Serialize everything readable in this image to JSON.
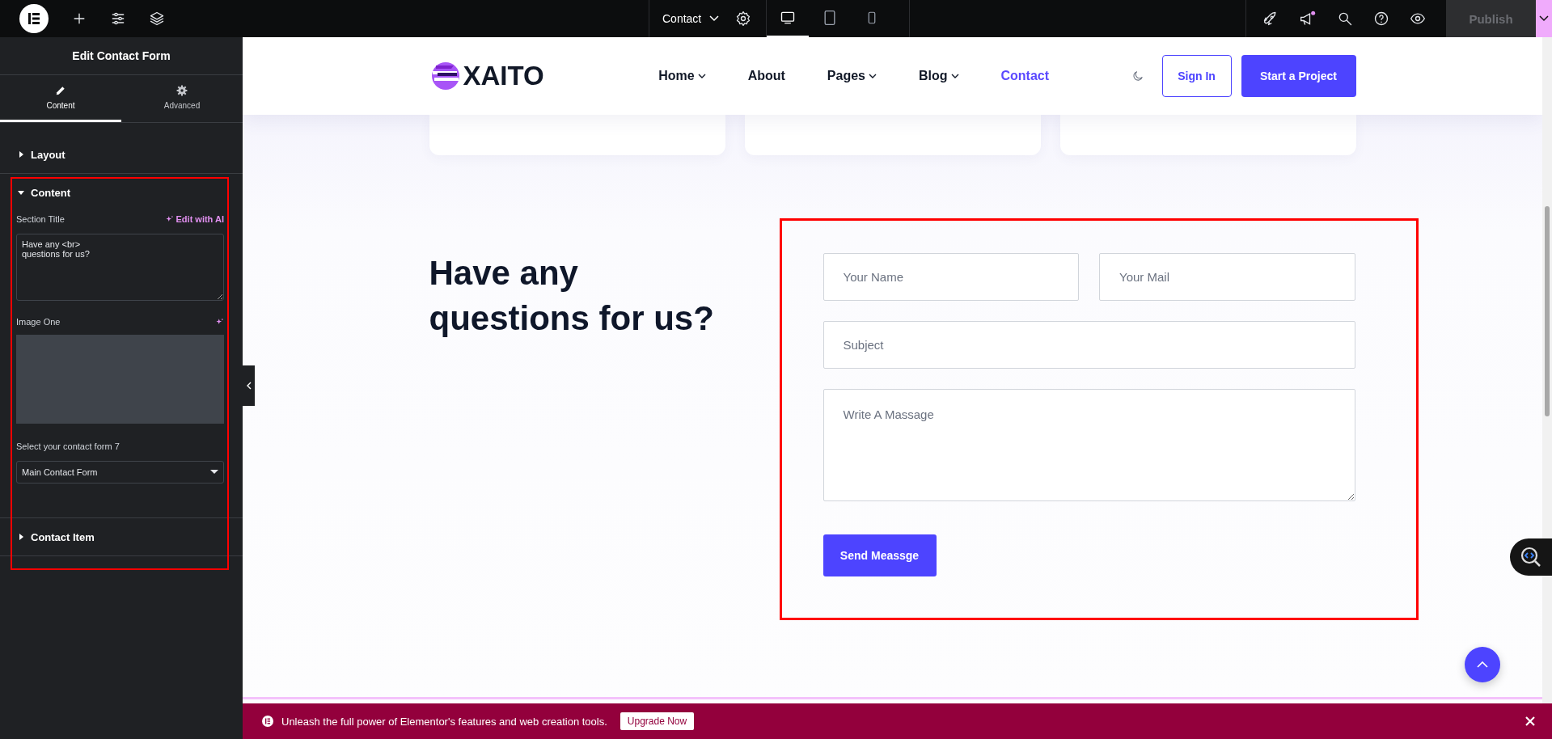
{
  "topbar": {
    "page_selector": "Contact",
    "devices": [
      {
        "kind": "desktop",
        "selected": true
      },
      {
        "kind": "tablet",
        "selected": false
      },
      {
        "kind": "mobile",
        "selected": false
      }
    ],
    "publish": {
      "label": "Publish",
      "disabled": true
    }
  },
  "panel": {
    "title": "Edit Contact Form",
    "tabs": [
      {
        "label": "Content",
        "kind": "content",
        "selected": true
      },
      {
        "label": "Advanced",
        "kind": "advanced",
        "selected": false
      }
    ],
    "sections": [
      {
        "title": "Layout",
        "expanded": false
      },
      {
        "title": "Content",
        "expanded": true,
        "section_title_label": "Section Title",
        "ai_label": "Edit with AI",
        "section_title_value": "Have any <br>\nquestions for us?",
        "image_label": "Image One",
        "select_label": "Select your contact form 7",
        "select_value": "Main Contact Form"
      },
      {
        "title": "Contact Item",
        "expanded": false
      }
    ]
  },
  "site": {
    "logo": "XAITO",
    "nav": [
      {
        "label": "Home",
        "dropdown": true,
        "selected": false
      },
      {
        "label": "About",
        "dropdown": false,
        "selected": false
      },
      {
        "label": "Pages",
        "dropdown": true,
        "selected": false
      },
      {
        "label": "Blog",
        "dropdown": true,
        "selected": false
      },
      {
        "label": "Contact",
        "dropdown": false,
        "selected": true
      }
    ],
    "sign_in": "Sign In",
    "cta": "Start a Project",
    "heading": "Have any questions for us?",
    "form": {
      "fields": [
        {
          "kind": "input",
          "placeholder": "Your Name"
        },
        {
          "kind": "input",
          "placeholder": "Your Mail"
        },
        {
          "kind": "input",
          "placeholder": "Subject"
        },
        {
          "kind": "textarea",
          "placeholder": "Write A Massage"
        }
      ],
      "submit": "Send Meassge"
    }
  },
  "banner": {
    "text": "Unleash the full power of Elementor's features and web creation tools.",
    "button": "Upgrade Now"
  }
}
